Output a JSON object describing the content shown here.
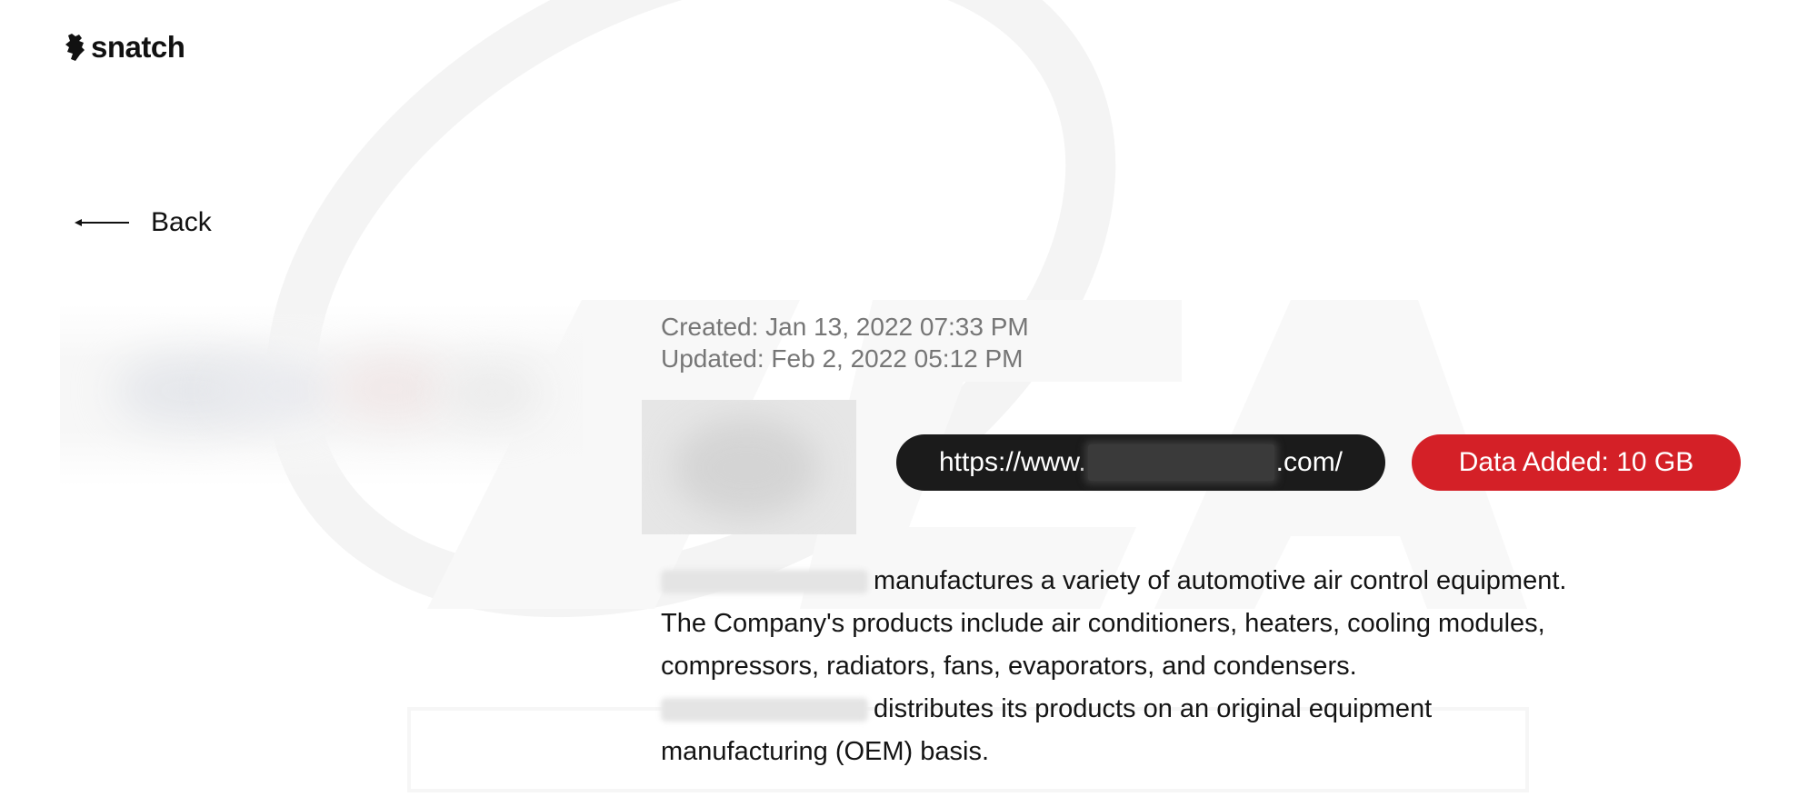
{
  "brand": {
    "name": "snatch",
    "logo_icon": "hand-icon"
  },
  "nav": {
    "back_label": "Back",
    "back_icon": "arrow-left-icon"
  },
  "meta": {
    "created": "Created: Jan 13, 2022 07:33 PM",
    "updated": "Updated: Feb 2, 2022 05:12 PM"
  },
  "badges": {
    "url_prefix": "https://www.",
    "url_suffix": ".com/",
    "data_added": "Data Added: 10 GB",
    "url_bg": "#1b1b1b",
    "data_bg": "#d42027"
  },
  "description": {
    "part1": "manufactures a variety of automotive air control equipment. The Company's products include air conditioners, heaters, cooling modules, compressors, radiators, fans, evaporators, and condensers.",
    "part2": "distributes its products on an original equipment manufacturing (OEM) basis."
  },
  "colors": {
    "accent_red": "#d42027",
    "dark": "#1b1b1b",
    "muted_text": "#767676"
  }
}
